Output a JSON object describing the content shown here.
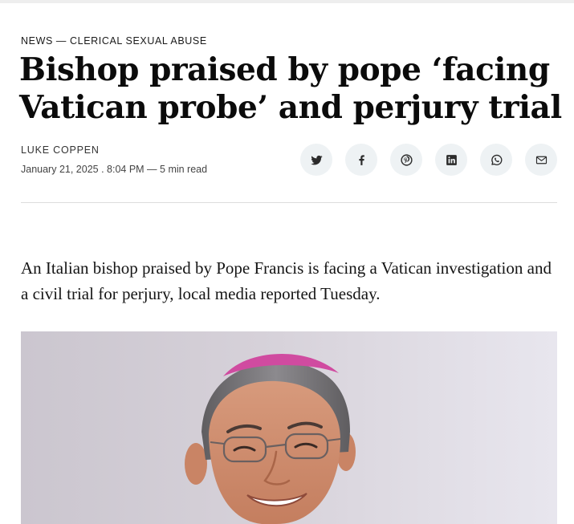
{
  "article": {
    "section": "NEWS",
    "separator": "—",
    "category": "CLERICAL SEXUAL ABUSE",
    "headline_line1": "Bishop praised by pope ‘facing",
    "headline_line2": "Vatican probe’ and perjury trial",
    "author": "LUKE COPPEN",
    "meta": "January 21, 2025 . 8:04 PM — 5 min read",
    "lede": "An Italian bishop praised by Pope Francis is facing a Vatican investigation and a civil trial for perjury, local media reported Tuesday."
  },
  "share": {
    "buttons": [
      {
        "icon": "twitter-icon"
      },
      {
        "icon": "facebook-icon"
      },
      {
        "icon": "pinterest-icon"
      },
      {
        "icon": "linkedin-icon"
      },
      {
        "icon": "whatsapp-icon"
      },
      {
        "icon": "email-icon"
      }
    ],
    "icon_color": "#2b2b2b",
    "button_bg": "#eef2f4"
  },
  "image": {
    "subject": "portrait of a smiling bishop with glasses and a magenta zucchetto"
  }
}
